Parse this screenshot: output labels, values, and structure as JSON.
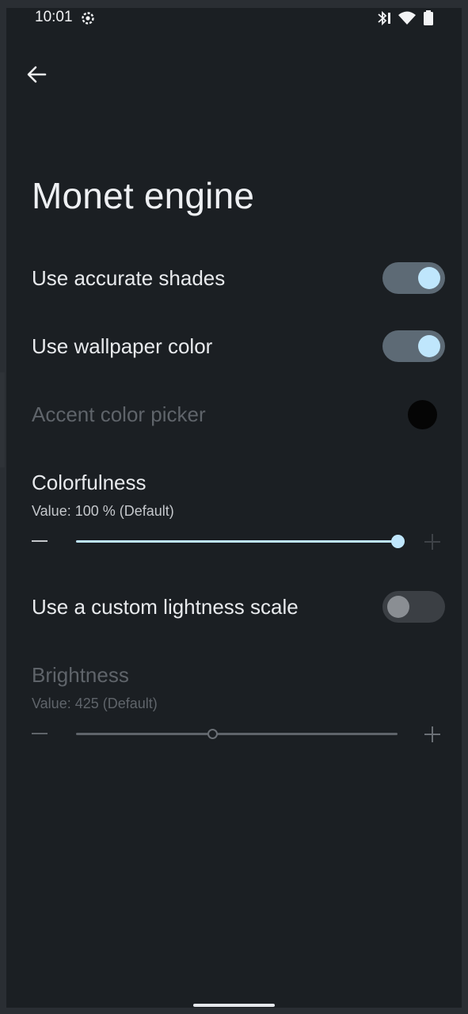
{
  "status_bar": {
    "time": "10:01",
    "icons": [
      "settings-gear-icon",
      "bluetooth-icon",
      "wifi-icon",
      "battery-icon"
    ]
  },
  "toolbar": {
    "back_icon": "arrow-left-icon"
  },
  "page": {
    "title": "Monet engine"
  },
  "settings": {
    "accurate_shades": {
      "label": "Use accurate shades",
      "enabled": true
    },
    "wallpaper_color": {
      "label": "Use wallpaper color",
      "enabled": true
    },
    "accent_picker": {
      "label": "Accent color picker",
      "color": "#050505",
      "disabled": true
    },
    "colorfulness": {
      "label": "Colorfulness",
      "value_text": "Value: 100 % (Default)",
      "value_percent": 100,
      "min": 0,
      "max": 100
    },
    "custom_lightness": {
      "label": "Use a custom lightness scale",
      "enabled": false
    },
    "brightness": {
      "label": "Brightness",
      "value_text": "Value: 425 (Default)",
      "value": 425,
      "position_fraction": 0.425,
      "disabled": true
    }
  },
  "colors": {
    "background": "#1b1f23",
    "accent": "#bfe6fc",
    "switch_on_track": "#5d6a75",
    "switch_off_track": "#3b3f44",
    "disabled_text": "#5f646a"
  }
}
